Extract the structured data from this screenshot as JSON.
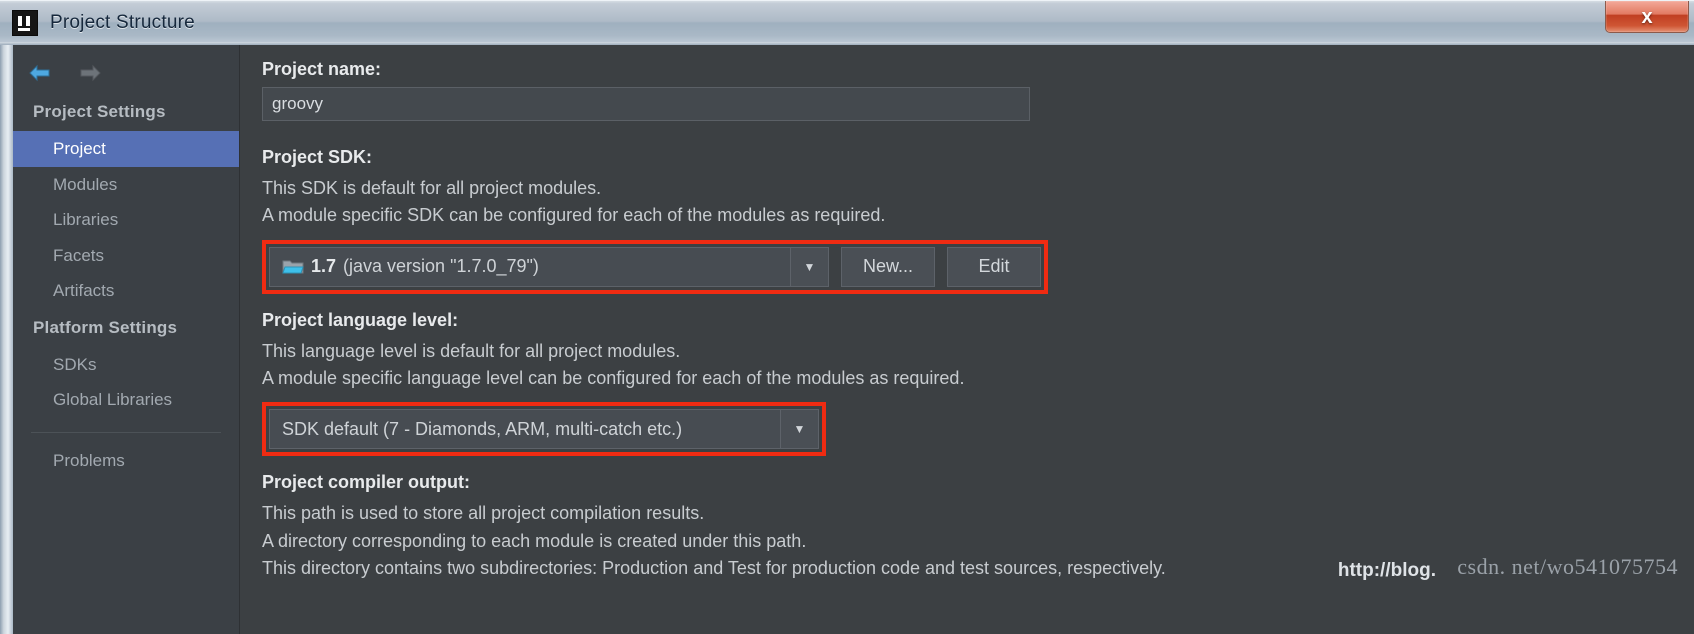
{
  "window": {
    "title": "Project Structure",
    "logo_icon": "intellij-idea-logo",
    "close_label": "x"
  },
  "sidebar": {
    "back_icon": "arrow-left-icon",
    "forward_icon": "arrow-right-icon",
    "groups": [
      {
        "header": "Project Settings",
        "items": [
          {
            "label": "Project",
            "selected": true
          },
          {
            "label": "Modules",
            "selected": false
          },
          {
            "label": "Libraries",
            "selected": false
          },
          {
            "label": "Facets",
            "selected": false
          },
          {
            "label": "Artifacts",
            "selected": false
          }
        ]
      },
      {
        "header": "Platform Settings",
        "items": [
          {
            "label": "SDKs",
            "selected": false
          },
          {
            "label": "Global Libraries",
            "selected": false
          }
        ]
      }
    ],
    "problems_label": "Problems"
  },
  "main": {
    "project_name": {
      "label": "Project name:",
      "value": "groovy"
    },
    "project_sdk": {
      "label": "Project SDK:",
      "desc1": "This SDK is default for all project modules.",
      "desc2": "A module specific SDK can be configured for each of the modules as required.",
      "combo_icon": "folder-icon",
      "combo_value_bold": "1.7",
      "combo_value_rest": "(java version \"1.7.0_79\")",
      "combo_arrow_icon": "chevron-down-icon",
      "new_button": "New...",
      "edit_button": "Edit"
    },
    "language_level": {
      "label": "Project language level:",
      "desc1": "This language level is default for all project modules.",
      "desc2": "A module specific language level can be configured for each of the modules as required.",
      "combo_value": "SDK default (7 - Diamonds, ARM, multi-catch etc.)",
      "combo_arrow_icon": "chevron-down-icon"
    },
    "compiler_output": {
      "label": "Project compiler output:",
      "desc1": "This path is used to store all project compilation results.",
      "desc2": "A directory corresponding to each module is created under this path.",
      "desc3": "This directory contains two subdirectories: Production and Test for production code and test sources, respectively."
    }
  },
  "watermark": {
    "text": "csdn. net/wo541075754",
    "overlap_text": "http://blog."
  },
  "colors": {
    "accent_selected": "#5670b5",
    "highlight_red": "#f02b12",
    "panel_bg": "#3c4043",
    "sidebar_bg": "#3b4045"
  }
}
